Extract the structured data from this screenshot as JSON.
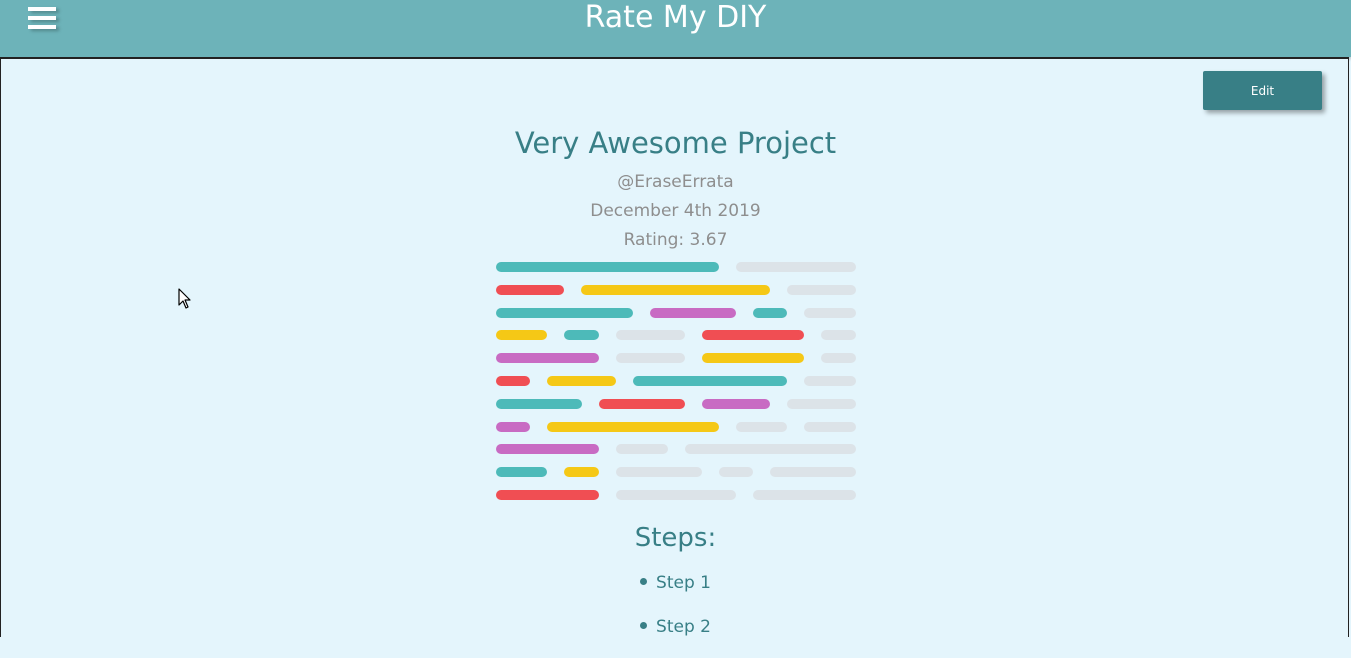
{
  "header": {
    "title": "Rate My DIY",
    "menu_icon": "hamburger-menu-icon"
  },
  "toolbar": {
    "edit_label": "Edit"
  },
  "project": {
    "title": "Very Awesome Project",
    "author": "@EraseErrata",
    "date": "December 4th 2019",
    "rating": "Rating: 3.67",
    "image": "code-lines-thumbnail"
  },
  "steps": {
    "heading": "Steps:",
    "items": [
      "Step 1",
      "Step 2"
    ]
  },
  "colors": {
    "header": "#6db3b9",
    "accent": "#387f86",
    "background": "#e4f5fc",
    "teal": "#4dbab9",
    "red": "#f04e53",
    "yellow": "#f5c816",
    "purple": "#c86bc3",
    "gray": "#dce3e8"
  }
}
